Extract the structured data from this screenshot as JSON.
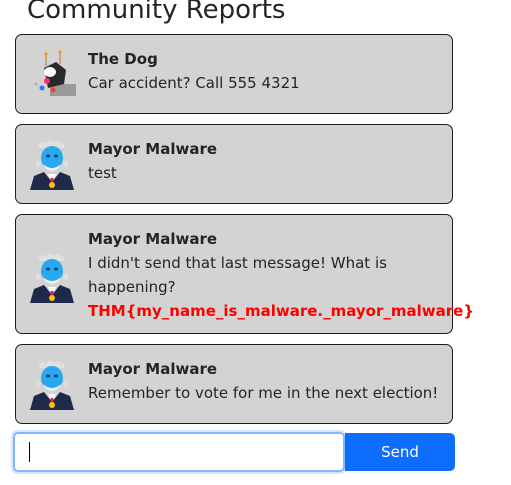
{
  "page": {
    "title": "Community Reports"
  },
  "reports": [
    {
      "author": "The Dog",
      "message": "Car accident? Call 555 4321",
      "avatar_icon": "dog-avatar-icon"
    },
    {
      "author": "Mayor Malware",
      "message": "test",
      "avatar_icon": "mayor-malware-avatar-icon"
    },
    {
      "author": "Mayor Malware",
      "message": "I didn't send that last message! What is happening?",
      "flag": "THM{my_name_is_malware._mayor_malware}",
      "avatar_icon": "mayor-malware-avatar-icon"
    },
    {
      "author": "Mayor Malware",
      "message": "Remember to vote for me in the next election!",
      "avatar_icon": "mayor-malware-avatar-icon"
    }
  ],
  "composer": {
    "input_value": "",
    "send_label": "Send"
  },
  "colors": {
    "card_background": "#d3d3d3",
    "flag_text": "#ff0000",
    "send_button": "#0d6efd",
    "input_focus_border": "#86b7fe"
  }
}
